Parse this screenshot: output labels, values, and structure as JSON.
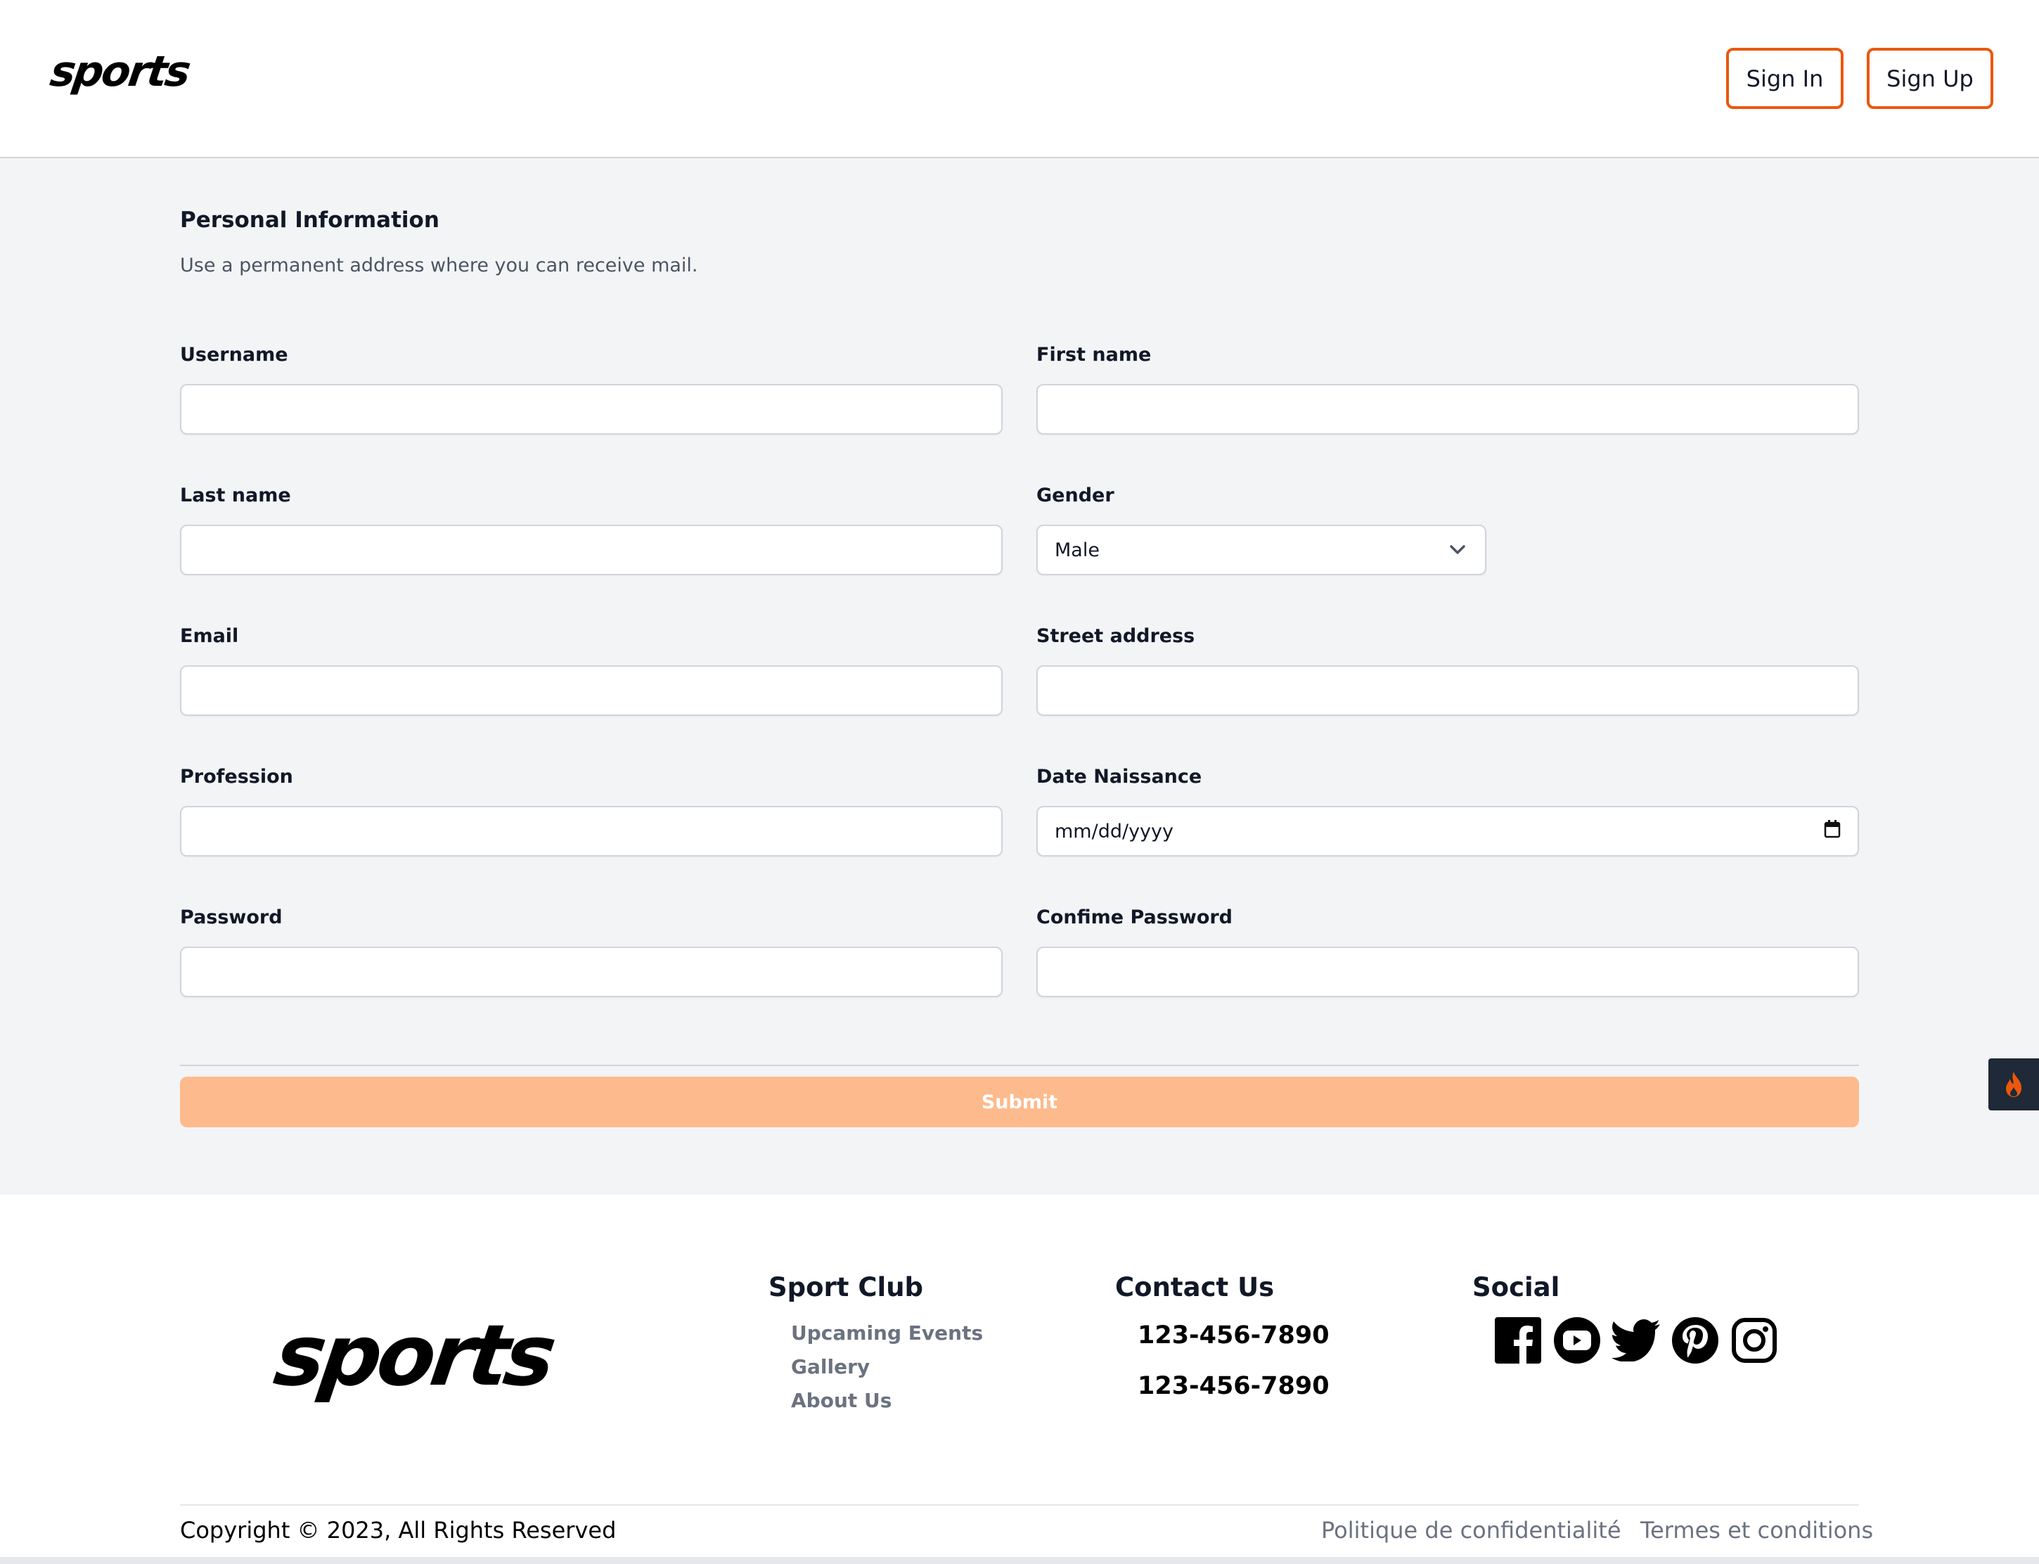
{
  "header": {
    "logo": "sports",
    "sign_in": "Sign In",
    "sign_up": "Sign Up"
  },
  "form": {
    "title": "Personal Information",
    "subtitle": "Use a permanent address where you can receive mail.",
    "fields": {
      "username": {
        "label": "Username",
        "value": ""
      },
      "first_name": {
        "label": "First name",
        "value": ""
      },
      "last_name": {
        "label": "Last name",
        "value": ""
      },
      "gender": {
        "label": "Gender",
        "value": "Male"
      },
      "email": {
        "label": "Email",
        "value": ""
      },
      "street_address": {
        "label": "Street address",
        "value": ""
      },
      "profession": {
        "label": "Profession",
        "value": ""
      },
      "date_naissance": {
        "label": "Date Naissance",
        "value": "mm/dd/yyyy"
      },
      "password": {
        "label": "Password",
        "value": ""
      },
      "confirm_password": {
        "label": "Confime Password",
        "value": ""
      }
    },
    "submit": "Submit",
    "colors": {
      "accent": "#ea580c",
      "submit_bg": "#fdba8c",
      "page_bg": "#f3f4f6"
    }
  },
  "side_tab": {
    "icon": "flame-icon"
  },
  "footer": {
    "logo": "sports",
    "sport_club": {
      "heading": "Sport Club",
      "links": [
        "Upcaming Events",
        "Gallery",
        "About Us"
      ]
    },
    "contact": {
      "heading": "Contact Us",
      "phones": [
        "123-456-7890",
        "123-456-7890"
      ]
    },
    "social": {
      "heading": "Social",
      "icons": [
        "facebook-icon",
        "youtube-icon",
        "twitter-icon",
        "pinterest-icon",
        "instagram-icon"
      ]
    },
    "copyright": "Copyright © 2023, All Rights Reserved",
    "privacy": "Politique de confidentialité",
    "terms": "Termes et conditions"
  }
}
